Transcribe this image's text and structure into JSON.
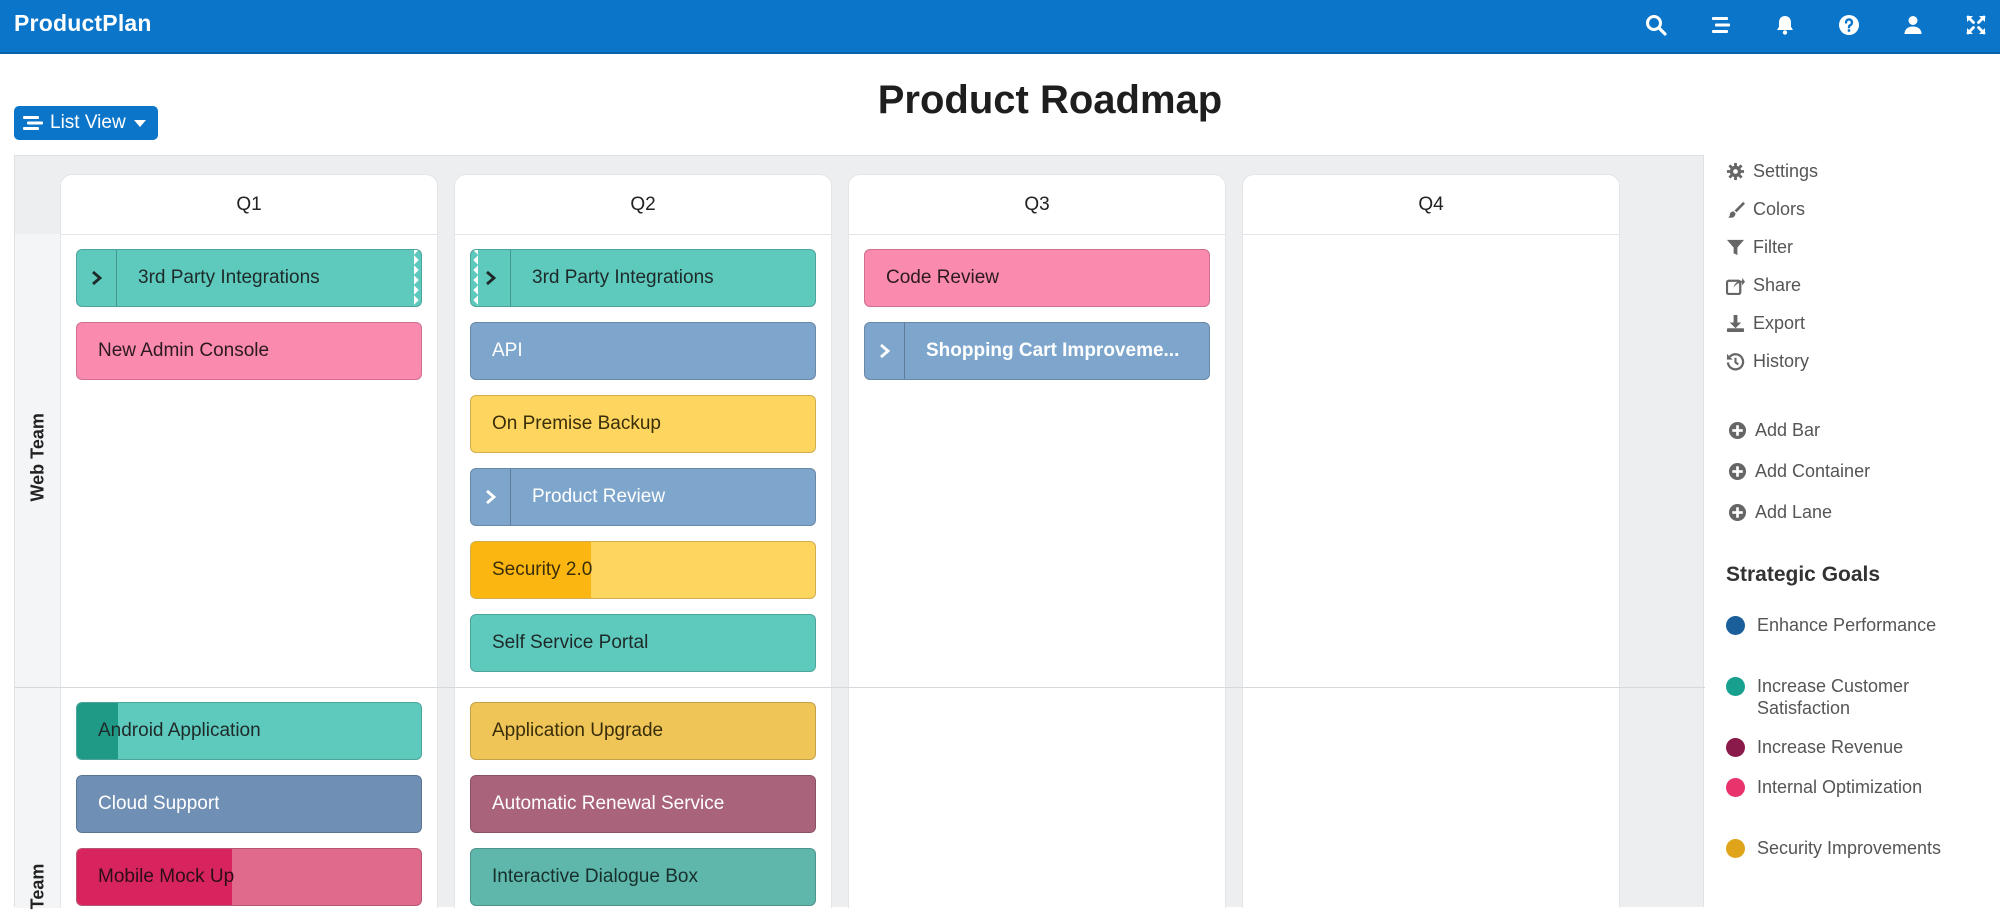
{
  "app": {
    "brand": "ProductPlan"
  },
  "toolbar": {
    "list_view_label": "List View"
  },
  "page": {
    "title": "Product Roadmap"
  },
  "columns": [
    "Q1",
    "Q2",
    "Q3",
    "Q4"
  ],
  "lanes": {
    "web_team": "Web Team",
    "second_team": "Team"
  },
  "bars": {
    "q1_third_party": "3rd Party Integrations",
    "q1_admin_console": "New Admin Console",
    "q1_android": "Android Application",
    "q1_cloud": "Cloud Support",
    "q1_mobile": "Mobile Mock Up",
    "q2_third_party": "3rd Party Integrations",
    "q2_api": "API",
    "q2_backup": "On Premise Backup",
    "q2_review": "Product Review",
    "q2_security": "Security 2.0",
    "q2_portal": "Self Service Portal",
    "q2_upgrade": "Application Upgrade",
    "q2_renewal": "Automatic Renewal Service",
    "q2_dialogue": "Interactive Dialogue Box",
    "q3_code_review": "Code Review",
    "q3_cart": "Shopping Cart Improveme..."
  },
  "progress": {
    "security_2_0": 0.35,
    "android_application": 0.12,
    "mobile_mock_up": 0.45
  },
  "side_menu": {
    "settings": "Settings",
    "colors": "Colors",
    "filter": "Filter",
    "share": "Share",
    "export": "Export",
    "history": "History",
    "add_bar": "Add Bar",
    "add_container": "Add Container",
    "add_lane": "Add Lane"
  },
  "strategic_goals": {
    "title": "Strategic Goals",
    "items": [
      {
        "label": "Enhance Performance",
        "color": "#1a5f9a"
      },
      {
        "label": "Increase Customer Satisfaction",
        "color": "#17a08e"
      },
      {
        "label": "Increase Revenue",
        "color": "#8a1a4a"
      },
      {
        "label": "Internal Optimization",
        "color": "#e8336d"
      },
      {
        "label": "Security Improvements",
        "color": "#e0a41a"
      }
    ]
  },
  "colors": {
    "brand_blue": "#0a75c9"
  },
  "icons": [
    "search-icon",
    "menu-lines-icon",
    "bell-icon",
    "help-icon",
    "user-icon",
    "fullscreen-icon",
    "list-view-icon",
    "gear-icon",
    "brush-icon",
    "filter-icon",
    "share-icon",
    "download-icon",
    "history-icon",
    "plus-circle-icon",
    "chevron-right-icon"
  ]
}
